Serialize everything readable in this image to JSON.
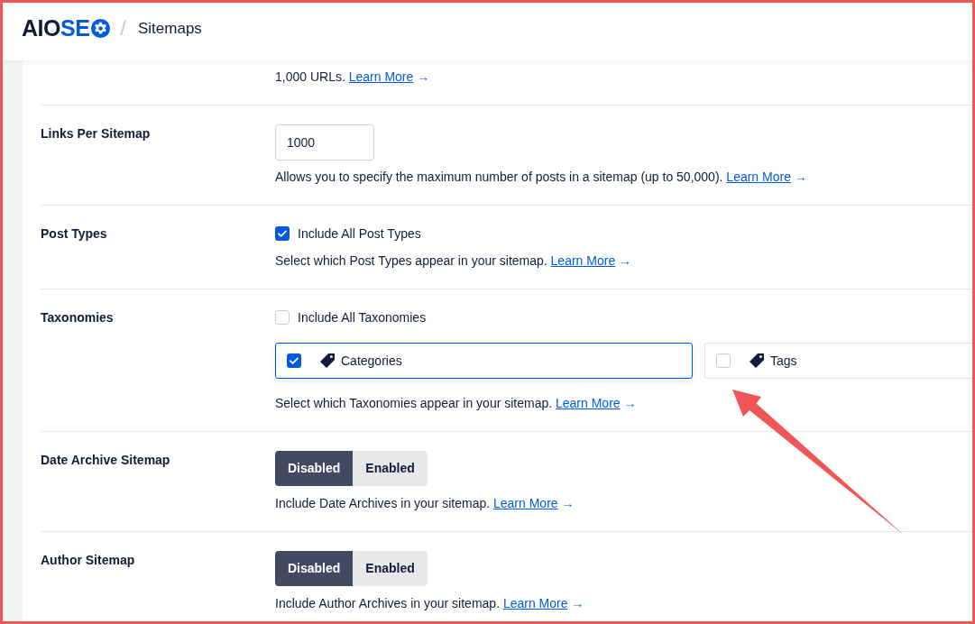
{
  "header": {
    "logo": {
      "dark_part": "AIO",
      "accent_part": "SE"
    },
    "separator": "/",
    "page_title": "Sitemaps"
  },
  "settings": [
    {
      "kind": "text_only",
      "description": "1,000 URLs.",
      "link": "Learn More",
      "link_arrow": "→"
    },
    {
      "kind": "number_input",
      "label": "Links Per Sitemap",
      "value": "1000",
      "description": "Allows you to specify the maximum number of posts in a sitemap (up to 50,000).",
      "link": "Learn More",
      "link_arrow": "→"
    },
    {
      "kind": "checkbox_list",
      "label": "Post Types",
      "include_all": {
        "label": "Include All Post Types",
        "checked": true
      },
      "description": "Select which Post Types appear in your sitemap.",
      "link": "Learn More",
      "link_arrow": "→"
    },
    {
      "kind": "checkbox_list",
      "label": "Taxonomies",
      "include_all": {
        "label": "Include All Taxonomies",
        "checked": false
      },
      "options": [
        {
          "label": "Categories",
          "checked": true,
          "selected": true
        },
        {
          "label": "Tags",
          "checked": false,
          "selected": false
        }
      ],
      "description": "Select which Taxonomies appear in your sitemap.",
      "link": "Learn More",
      "link_arrow": "→"
    },
    {
      "kind": "toggle",
      "label": "Date Archive Sitemap",
      "buttons": [
        {
          "label": "Disabled",
          "selected": true
        },
        {
          "label": "Enabled",
          "selected": false
        }
      ],
      "description": "Include Date Archives in your sitemap.",
      "link": "Learn More",
      "link_arrow": "→"
    },
    {
      "kind": "toggle",
      "label": "Author Sitemap",
      "buttons": [
        {
          "label": "Disabled",
          "selected": true
        },
        {
          "label": "Enabled",
          "selected": false
        }
      ],
      "description": "Include Author Archives in your sitemap.",
      "link": "Learn More",
      "link_arrow": "→"
    }
  ]
}
